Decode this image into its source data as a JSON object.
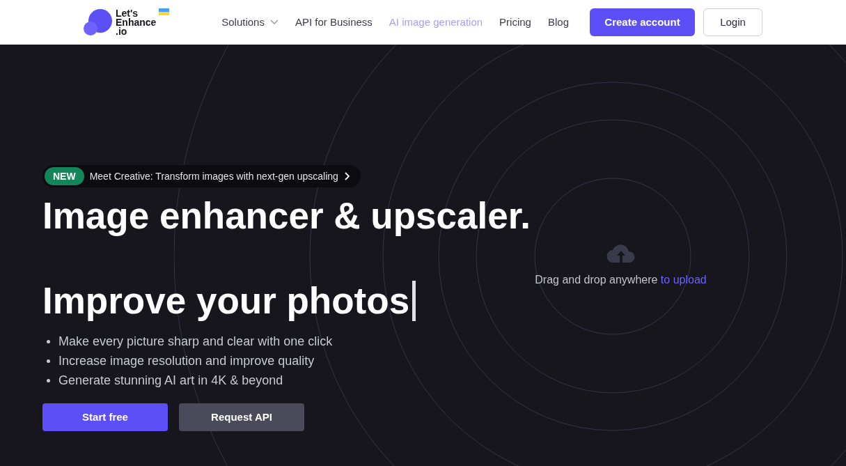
{
  "header": {
    "logo": {
      "line_1": "Let's",
      "line_2": "Enhance",
      "line_3": ".io"
    },
    "nav": [
      {
        "label": "Solutions",
        "kind": "dropdown",
        "selected": false
      },
      {
        "label": "API for Business",
        "kind": "link",
        "selected": false
      },
      {
        "label": "AI image generation",
        "kind": "link",
        "selected": true
      },
      {
        "label": "Pricing",
        "kind": "link",
        "selected": false
      },
      {
        "label": "Blog",
        "kind": "link",
        "selected": false
      }
    ],
    "buttons": [
      {
        "label": "Create account",
        "kind": "primary"
      },
      {
        "label": "Login",
        "kind": "outline"
      }
    ]
  },
  "hero": {
    "announcement": {
      "badge": "NEW",
      "text": "Meet Creative: Transform images with next-gen upscaling"
    },
    "title": "Image enhancer & upscaler.",
    "subtitle": "Improve your photos",
    "bullets": [
      "Make every picture sharp and clear with one click",
      "Increase image resolution and improve quality",
      "Generate stunning AI art in 4K & beyond"
    ],
    "buttons": [
      {
        "label": "Start free",
        "kind": "primary"
      },
      {
        "label": "Request API",
        "kind": "secondary"
      }
    ],
    "upload": {
      "text": "Drag and drop anywhere",
      "link": "to upload"
    }
  }
}
